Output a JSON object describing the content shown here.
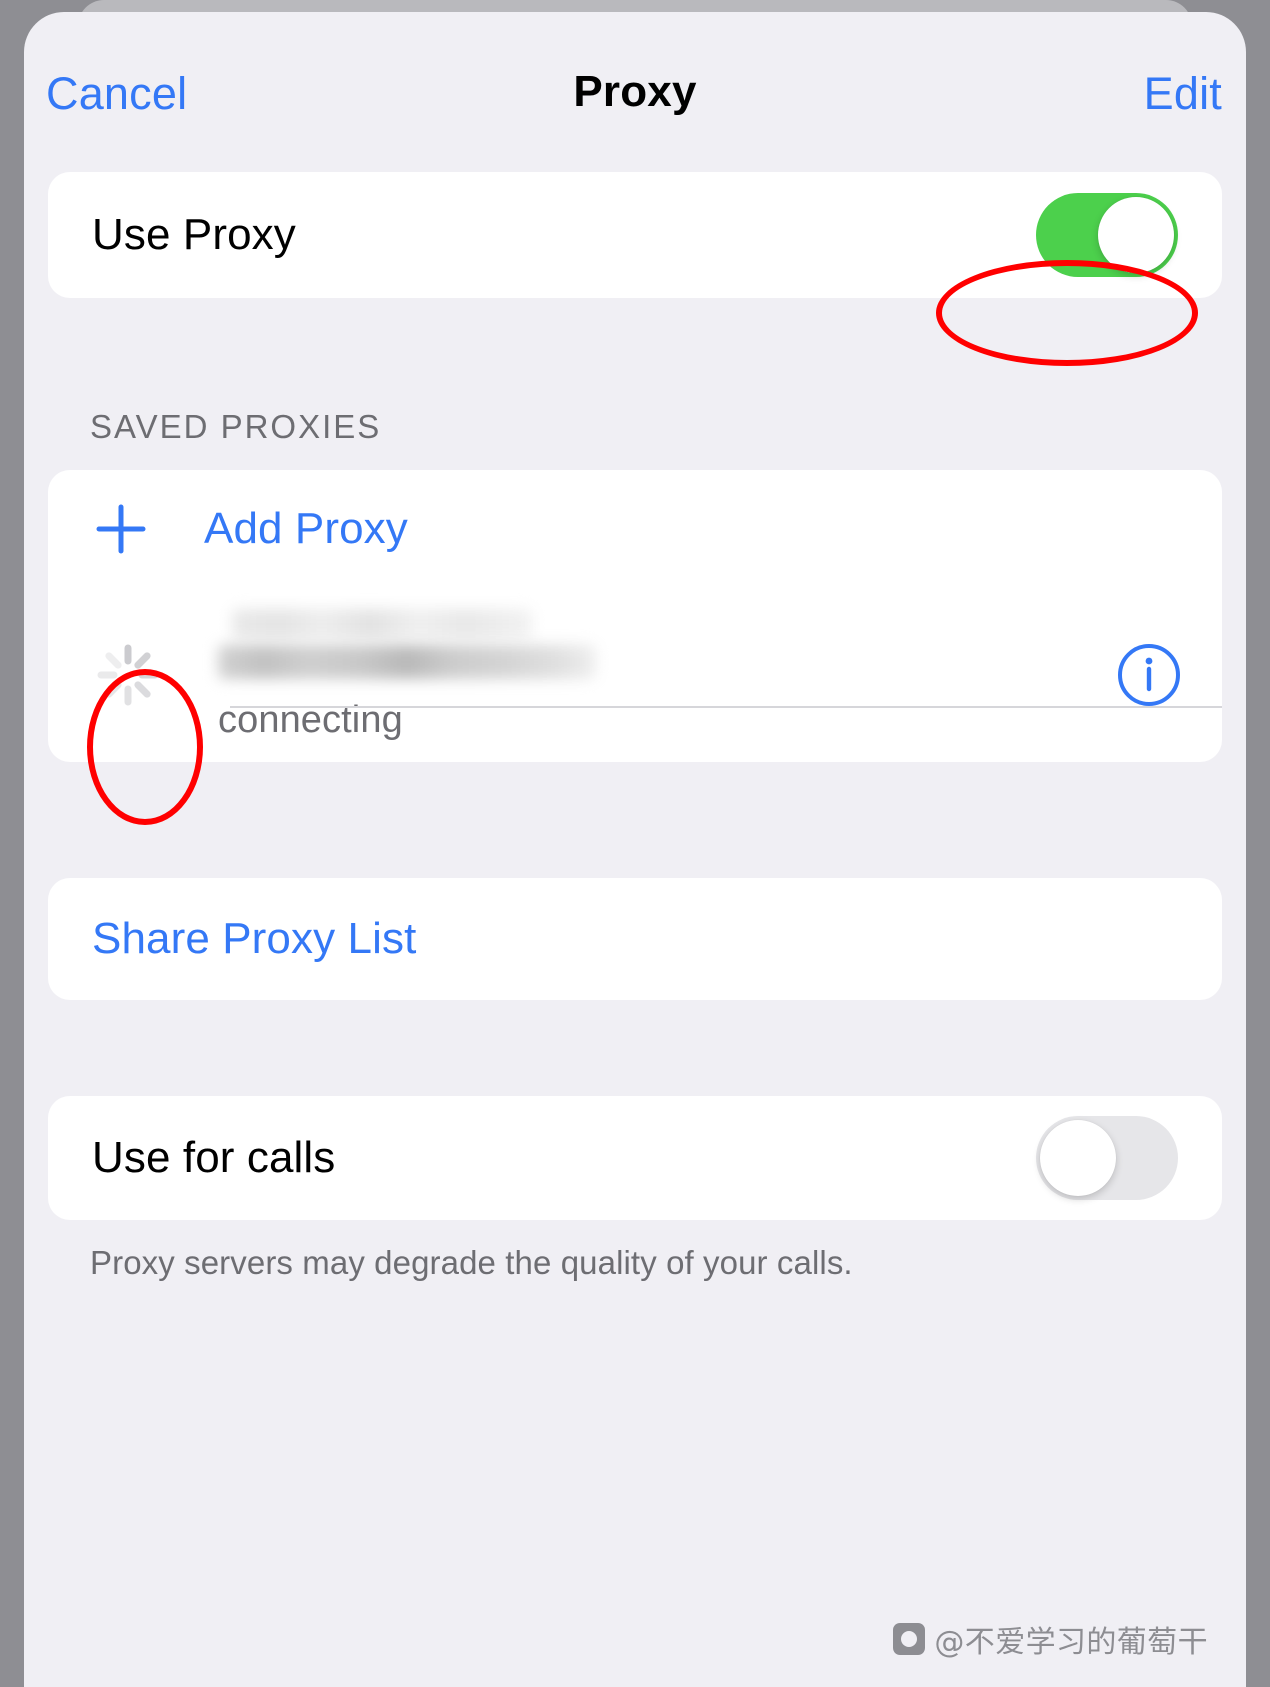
{
  "navbar": {
    "cancel_label": "Cancel",
    "title": "Proxy",
    "edit_label": "Edit"
  },
  "use_proxy": {
    "label": "Use Proxy",
    "enabled": true,
    "toggle_state": "on",
    "annotation": "red-ellipse-highlight"
  },
  "saved_proxies": {
    "section_header": "SAVED PROXIES",
    "add_proxy_label": "Add Proxy",
    "add_proxy_icon": "plus-icon",
    "items": [
      {
        "name": "",
        "name_redacted": true,
        "status": "connecting",
        "status_icon": "activity-spinner-icon",
        "info_icon": "info-circle-icon",
        "annotation": "red-ellipse-highlight"
      }
    ]
  },
  "share": {
    "label": "Share Proxy List"
  },
  "use_for_calls": {
    "label": "Use for calls",
    "enabled": false,
    "toggle_state": "off",
    "footer": "Proxy servers may degrade the quality of your calls."
  },
  "watermark": {
    "text": "@不爱学习的葡萄干"
  },
  "colors": {
    "accent_blue": "#3478f6",
    "toggle_on_green": "#4cd04c",
    "toggle_off_gray": "#e6e6e9",
    "page_background": "#f0eff4",
    "card_background": "#ffffff",
    "secondary_text": "#6d6d72",
    "annotation_red": "#ff0000"
  }
}
